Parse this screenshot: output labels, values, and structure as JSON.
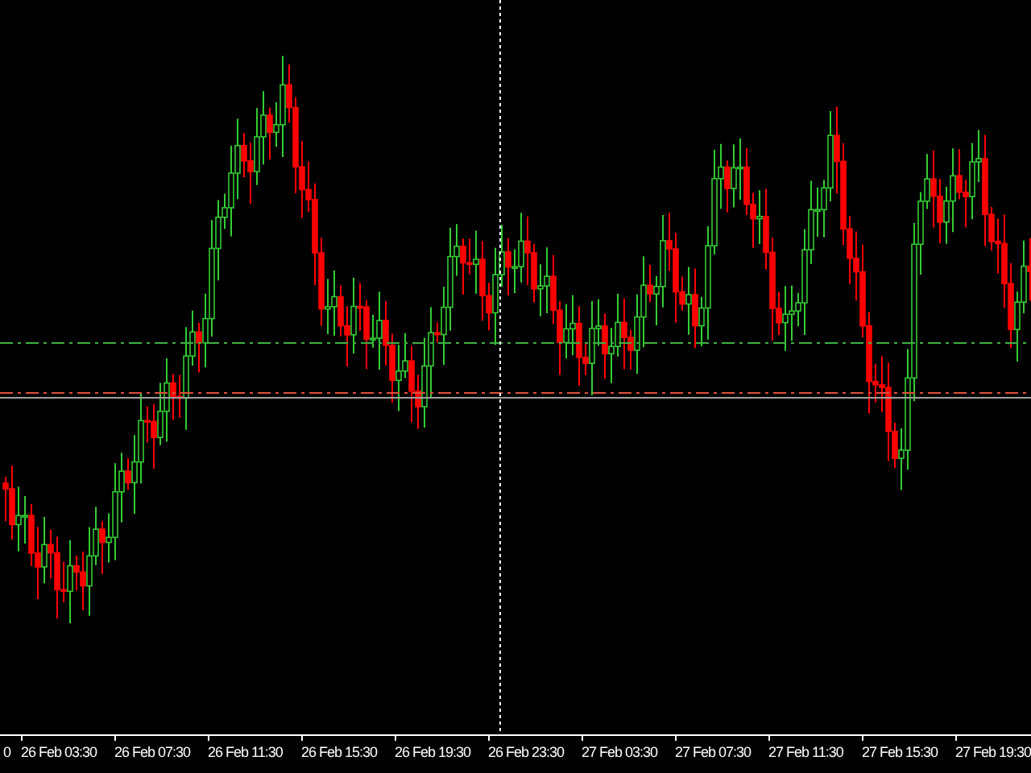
{
  "chart": {
    "time_axis": {
      "labels": [
        "0",
        "26 Feb 03:30",
        "26 Feb 07:30",
        "26 Feb 11:30",
        "26 Feb 15:30",
        "26 Feb 19:30",
        "26 Feb 23:30",
        "27 Feb 03:30",
        "27 Feb 07:30",
        "27 Feb 11:30",
        "27 Feb 15:30",
        "27 Feb 19:30"
      ]
    }
  }
}
